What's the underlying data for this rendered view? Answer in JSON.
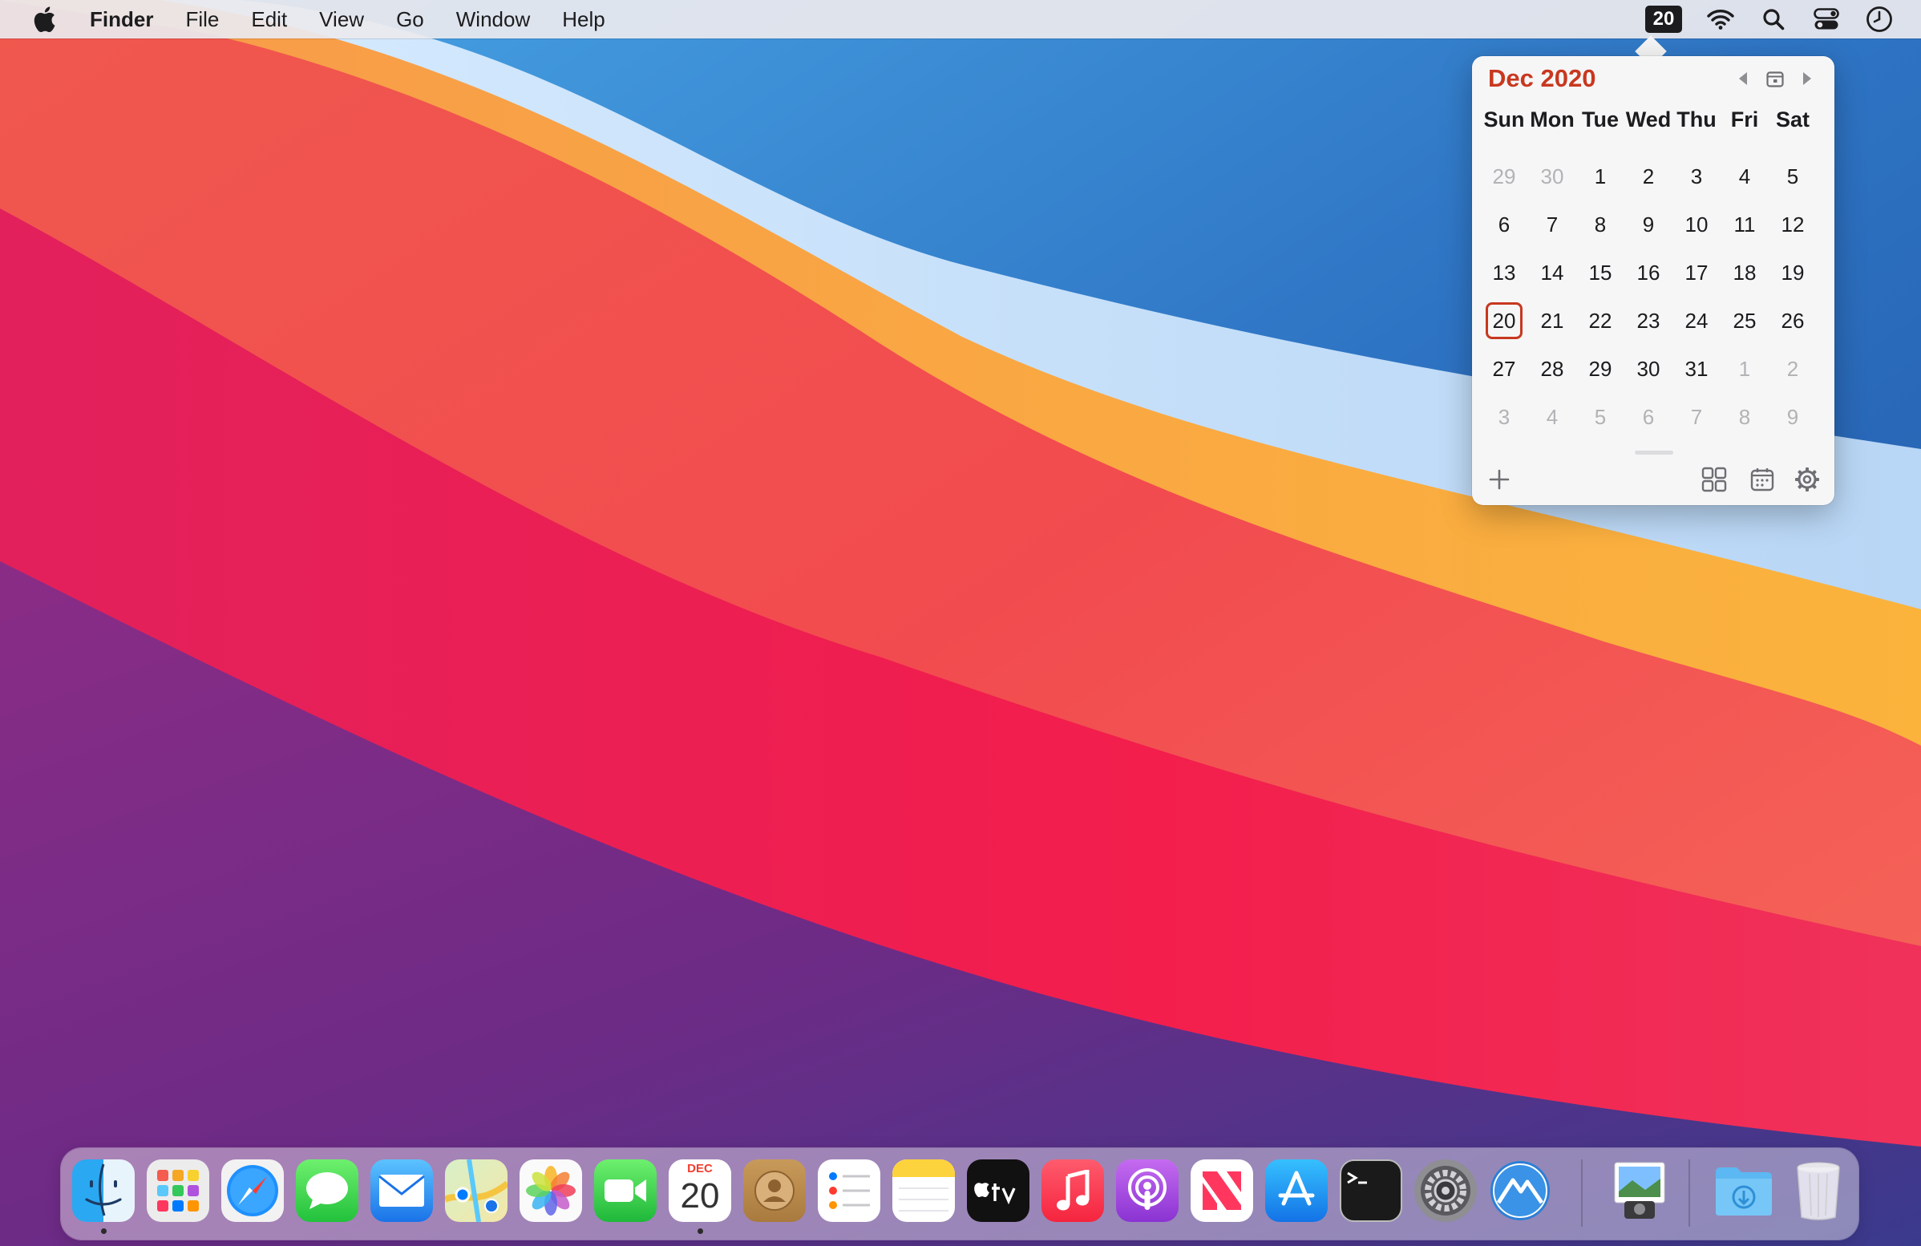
{
  "menubar": {
    "app_name": "Finder",
    "items": [
      "File",
      "Edit",
      "View",
      "Go",
      "Window",
      "Help"
    ],
    "date_badge": "20",
    "icons": [
      "wifi-icon",
      "search-icon",
      "control-center-icon",
      "clock-icon"
    ]
  },
  "calendar": {
    "title": "Dec 2020",
    "weekdays": [
      "Sun",
      "Mon",
      "Tue",
      "Wed",
      "Thu",
      "Fri",
      "Sat"
    ],
    "weeks": [
      [
        "29",
        "30",
        "1",
        "2",
        "3",
        "4",
        "5"
      ],
      [
        "6",
        "7",
        "8",
        "9",
        "10",
        "11",
        "12"
      ],
      [
        "13",
        "14",
        "15",
        "16",
        "17",
        "18",
        "19"
      ],
      [
        "20",
        "21",
        "22",
        "23",
        "24",
        "25",
        "26"
      ],
      [
        "27",
        "28",
        "29",
        "30",
        "31",
        "1",
        "2"
      ],
      [
        "3",
        "4",
        "5",
        "6",
        "7",
        "8",
        "9"
      ]
    ],
    "today": "20",
    "accent_color": "#c8381f"
  },
  "dock": {
    "calendar_icon": {
      "month": "DEC",
      "day": "20"
    },
    "apps": [
      "Finder",
      "Launchpad",
      "Safari",
      "Messages",
      "Mail",
      "Maps",
      "Photos",
      "FaceTime",
      "Calendar",
      "Contacts",
      "Reminders",
      "Notes",
      "TV",
      "Music",
      "Podcasts",
      "News",
      "App Store",
      "Terminal",
      "System Preferences",
      "Itsycal",
      "Preview",
      "Downloads",
      "Trash"
    ]
  }
}
